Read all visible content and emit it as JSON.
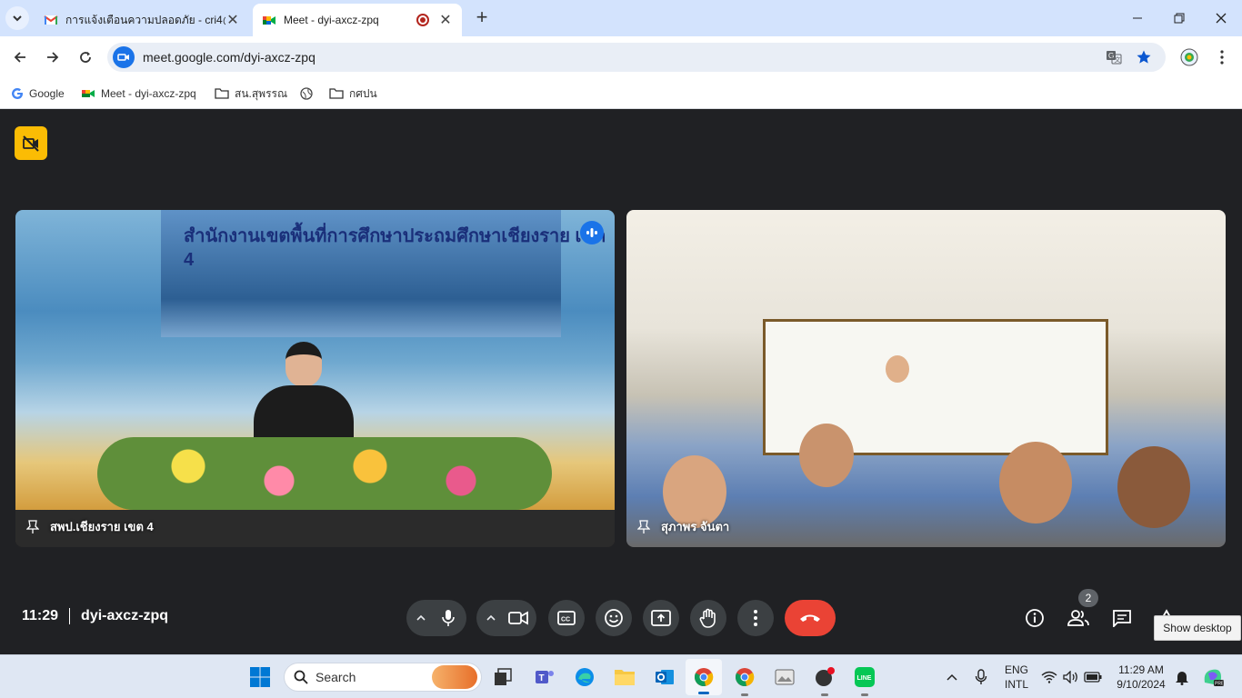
{
  "browser": {
    "tabs": [
      {
        "title": "การแจ้งเตือนความปลอดภัย - cri4@",
        "state": "inactive"
      },
      {
        "title": "Meet - dyi-axcz-zpq",
        "state": "active",
        "recording": true
      }
    ],
    "url": "meet.google.com/dyi-axcz-zpq",
    "bookmarks": [
      {
        "label": "Google",
        "icon": "google-icon"
      },
      {
        "label": "Meet - dyi-axcz-zpq",
        "icon": "meet-icon"
      },
      {
        "label": "สน.สุพรรณ",
        "icon": "folder-icon"
      },
      {
        "label": "",
        "icon": "globe-icon"
      },
      {
        "label": "กศปน",
        "icon": "folder-icon"
      }
    ]
  },
  "meet": {
    "tiles": [
      {
        "name": "สพป.เชียงราย เขต 4",
        "speaking": true,
        "banner": "สำนักงานเขตพื้นที่การศึกษาประถมศึกษาเชียงราย เขต 4"
      },
      {
        "name": "สุภาพร จันตา",
        "speaking": false
      }
    ],
    "time": "11:29",
    "meeting_code": "dyi-axcz-zpq",
    "participants_count": "2",
    "tooltip": "Show desktop",
    "colors": {
      "background": "#202124",
      "control": "#3c4043",
      "end_call": "#ea4335",
      "accent": "#1a73e8",
      "camera_off_badge": "#fbbc04"
    }
  },
  "taskbar": {
    "search_label": "Search",
    "language": "ENG",
    "layout": "INTL",
    "clock_time": "11:29 AM",
    "clock_date": "9/10/2024"
  }
}
